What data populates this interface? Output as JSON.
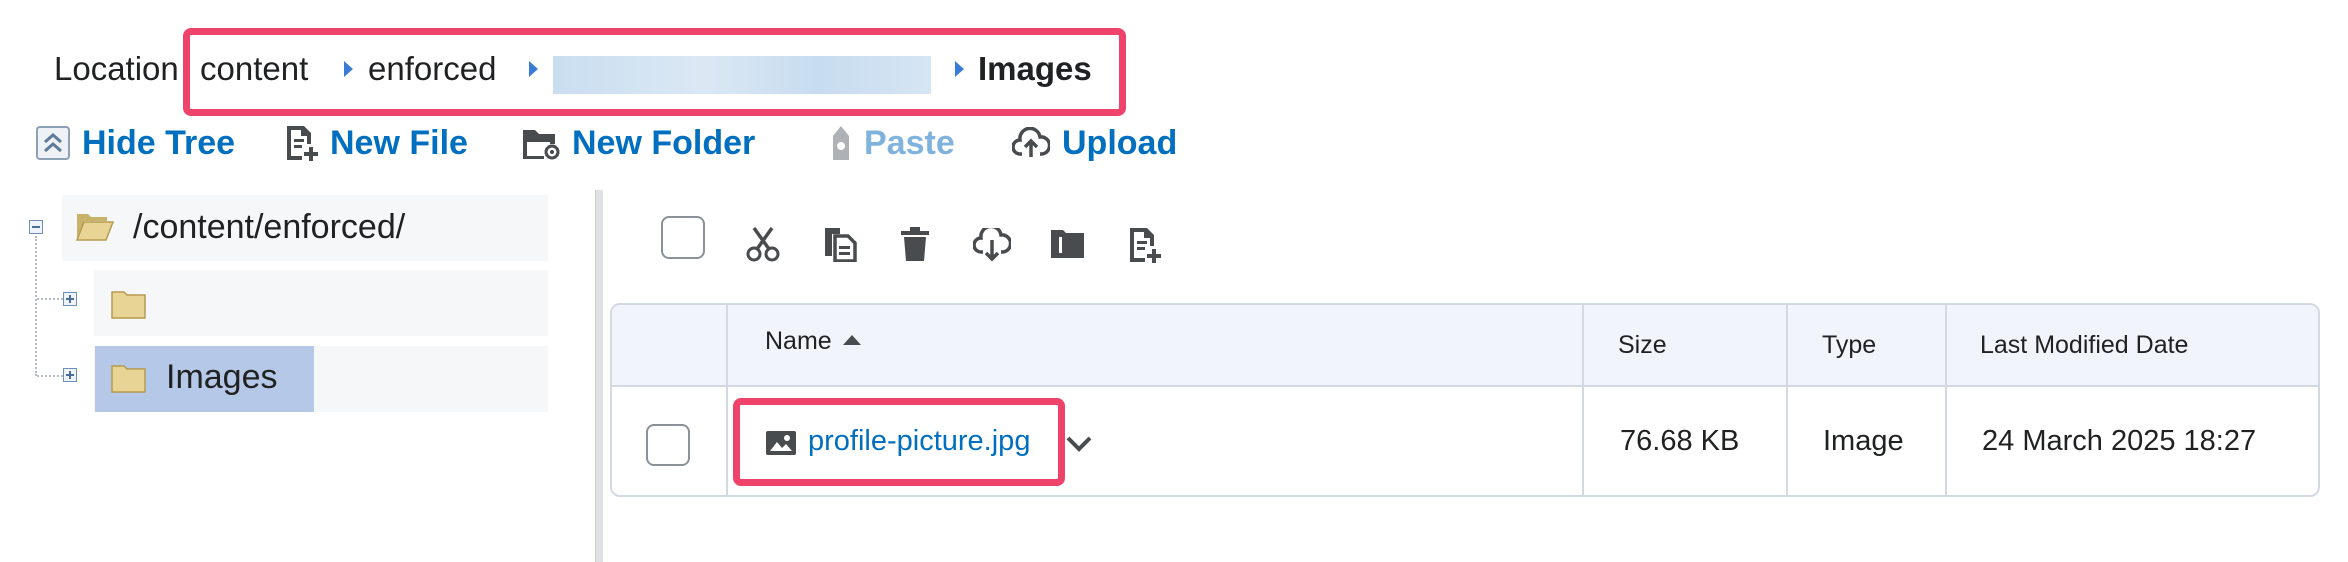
{
  "breadcrumb": {
    "label": "Location",
    "items": [
      "content",
      "enforced",
      ""
    ],
    "current": "Images"
  },
  "toolbar": {
    "hide_tree": "Hide Tree",
    "new_file": "New File",
    "new_folder": "New Folder",
    "paste": "Paste",
    "upload": "Upload"
  },
  "tree": {
    "root": "/content/enforced/",
    "children": [
      "",
      "Images"
    ],
    "selected": "Images"
  },
  "file_actions": [
    "cut-icon",
    "copy-icon",
    "delete-icon",
    "download-icon",
    "move-icon",
    "new-file-icon"
  ],
  "table": {
    "columns": {
      "name": "Name",
      "size": "Size",
      "type": "Type",
      "modified": "Last Modified Date"
    },
    "sort": {
      "column": "name",
      "direction": "ascending"
    },
    "rows": [
      {
        "name": "profile-picture.jpg",
        "size": "76.68 KB",
        "type": "Image",
        "modified": "24 March 2025 18:27"
      }
    ]
  },
  "colors": {
    "link": "#006fbf",
    "link_disabled": "#7fb3de",
    "highlight": "#f0436b",
    "tree_selected": "#b6c8e8"
  }
}
